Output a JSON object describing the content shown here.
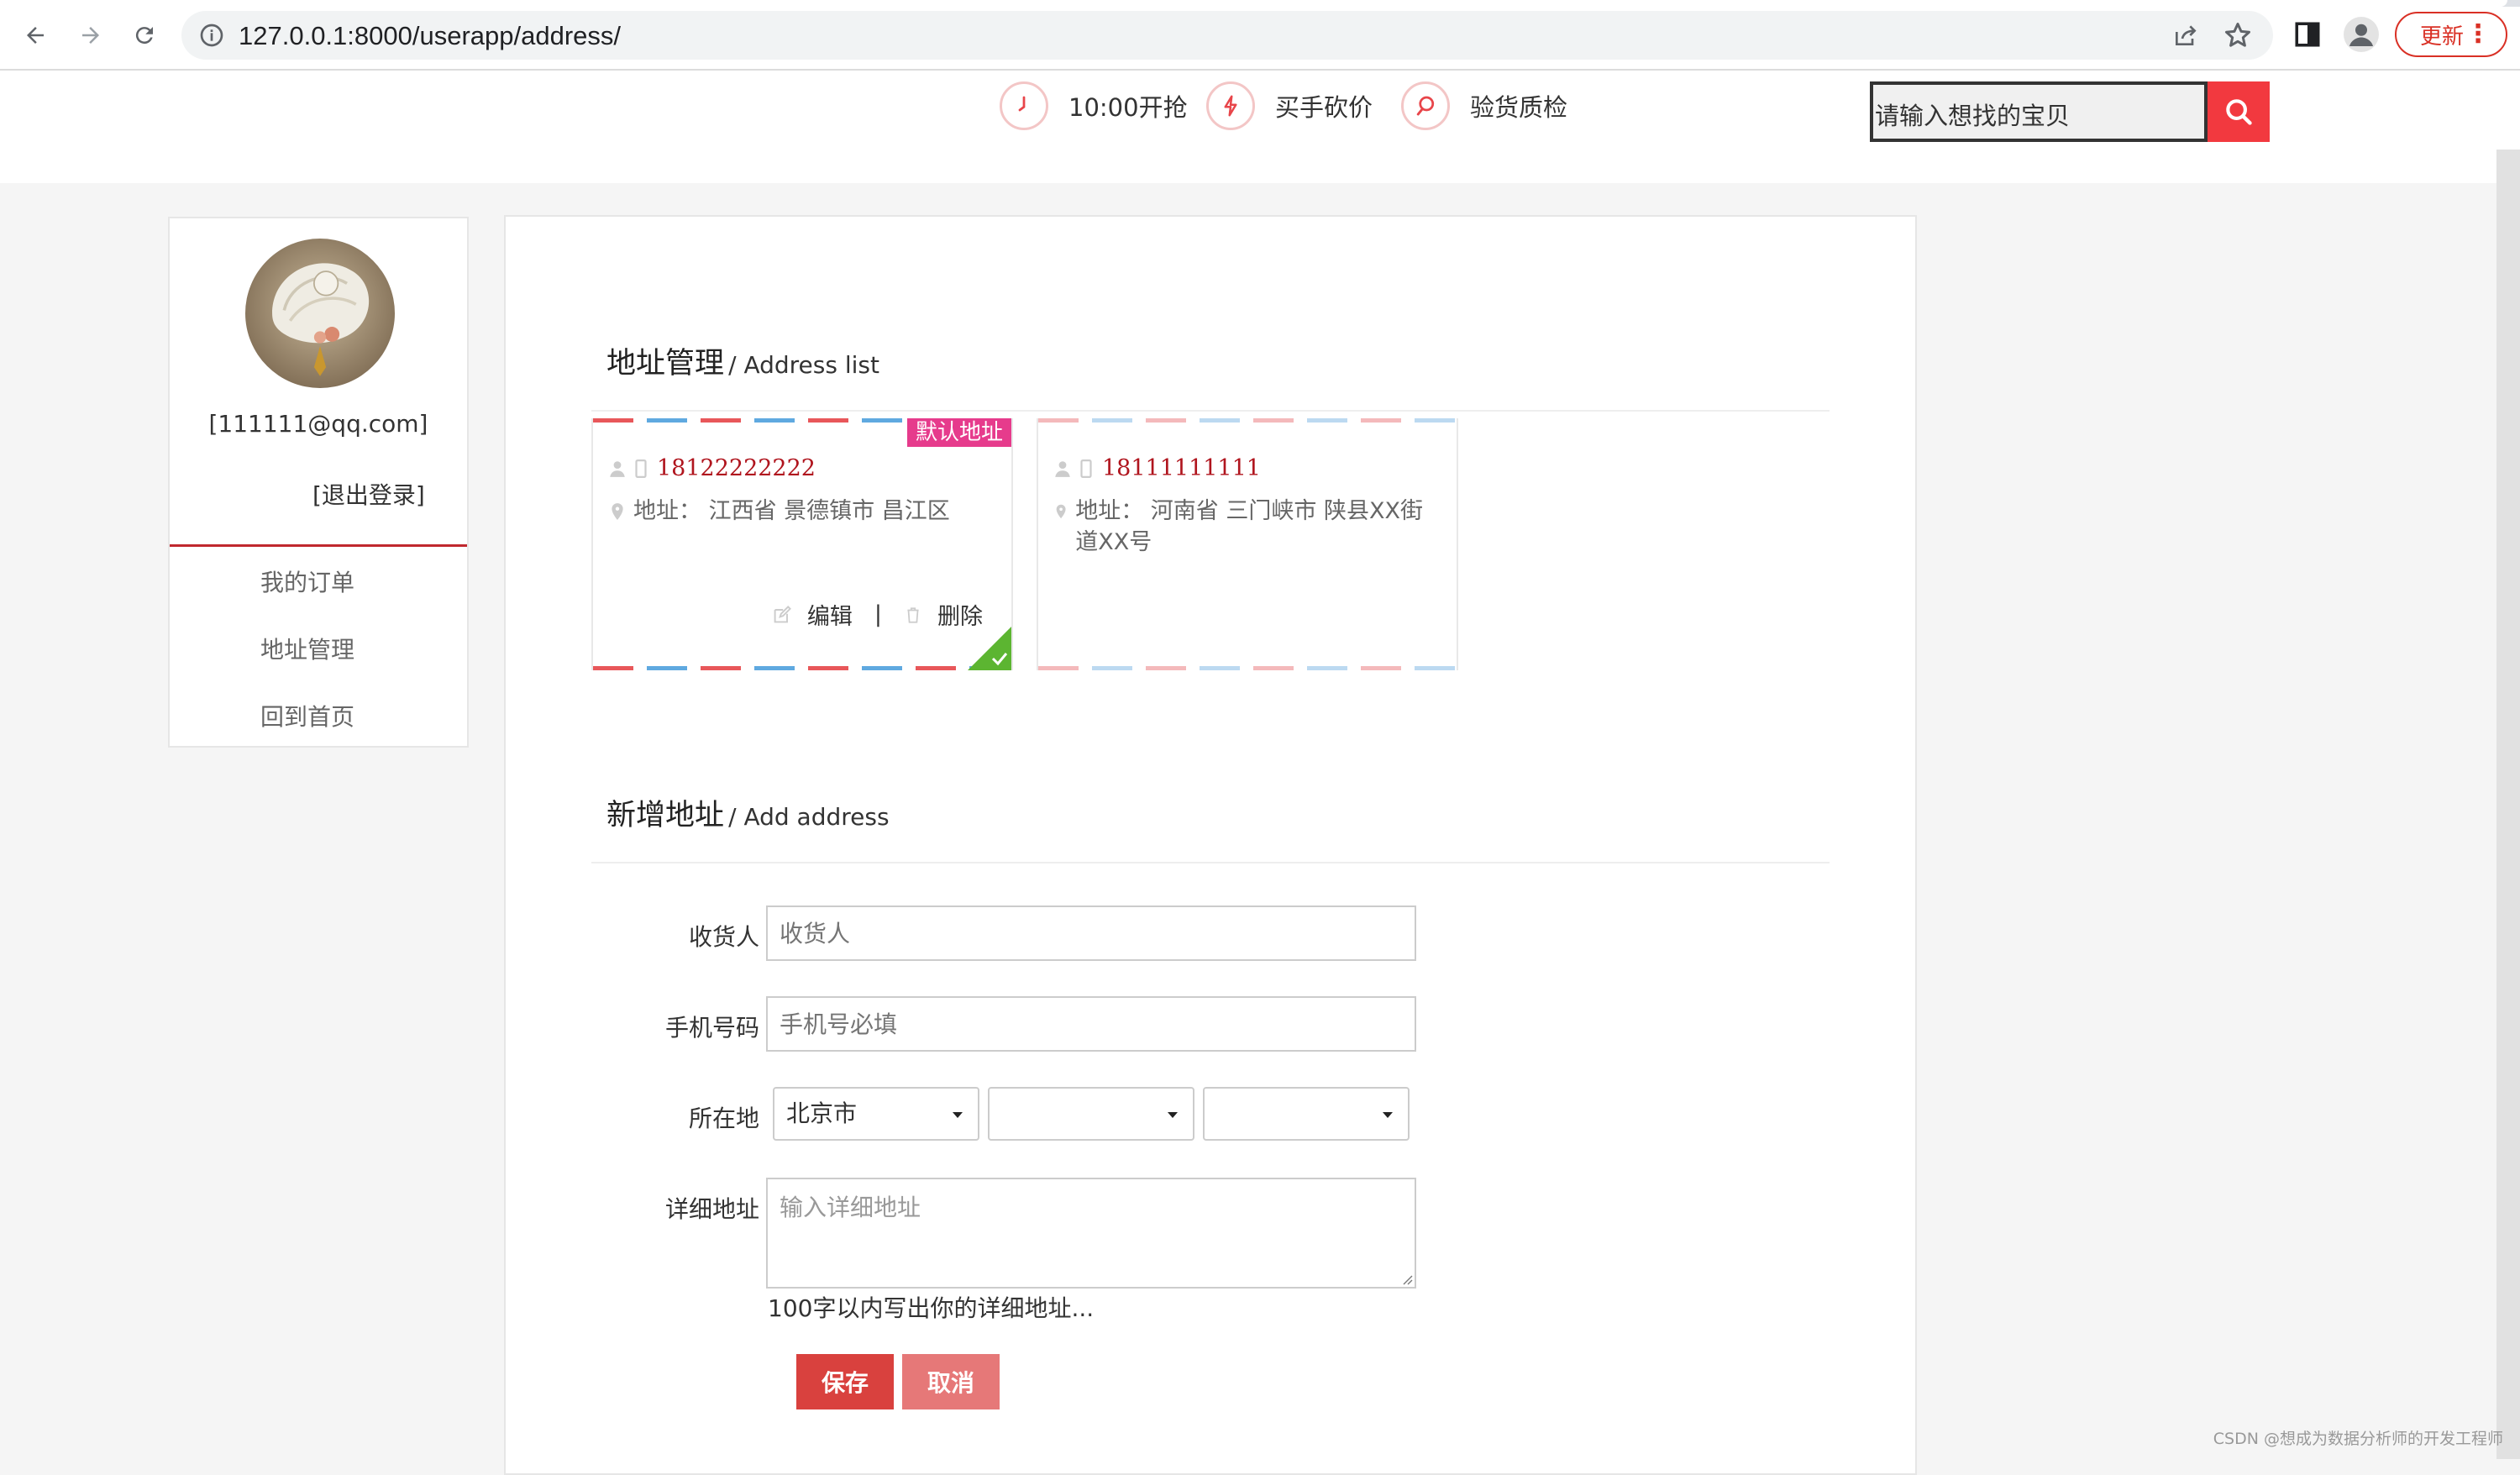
{
  "browser": {
    "url": "127.0.0.1:8000/userapp/address/",
    "update_label": "更新"
  },
  "header": {
    "features": [
      {
        "icon": "clock-icon",
        "label": "10:00开抢"
      },
      {
        "icon": "lightning-icon",
        "label": "买手砍价"
      },
      {
        "icon": "magnifier-icon",
        "label": "验货质检"
      }
    ],
    "search": {
      "text": "请输入想找的宝贝"
    }
  },
  "user": {
    "email": "[111111@qq.com]",
    "logout_label": "[退出登录]",
    "menu": [
      {
        "label": "我的订单"
      },
      {
        "label": "地址管理"
      },
      {
        "label": "回到首页"
      }
    ]
  },
  "address_list": {
    "title": "地址管理",
    "subtitle": "/ Address list",
    "default_tag": "默认地址",
    "edit_label": "编辑",
    "separator": "|",
    "delete_label": "删除",
    "cards": [
      {
        "phone": "18122222222",
        "address_label": "地址：",
        "address": "江西省 景德镇市 昌江区",
        "is_default": true
      },
      {
        "phone": "18111111111",
        "address_label": "地址：",
        "address": "河南省 三门峡市 陕县XX街道XX号",
        "is_default": false
      }
    ]
  },
  "add_address": {
    "title": "新增地址",
    "subtitle": "/ Add address",
    "fields": {
      "receiver": {
        "label": "收货人",
        "placeholder": "收货人"
      },
      "phone": {
        "label": "手机号码",
        "placeholder": "手机号必填"
      },
      "location": {
        "label": "所在地",
        "province": "北京市",
        "city": "",
        "district": ""
      },
      "detail": {
        "label": "详细地址",
        "placeholder": "输入详细地址",
        "hint": "100字以内写出你的详细地址..."
      }
    },
    "save_label": "保存",
    "cancel_label": "取消"
  },
  "watermark": "CSDN @想成为数据分析师的开发工程师",
  "colors": {
    "accent_red": "#d9413e",
    "search_button": "#f2393f",
    "default_tag": "#e63b8c",
    "phone_text": "#b0151e",
    "default_check": "#5cb531"
  }
}
